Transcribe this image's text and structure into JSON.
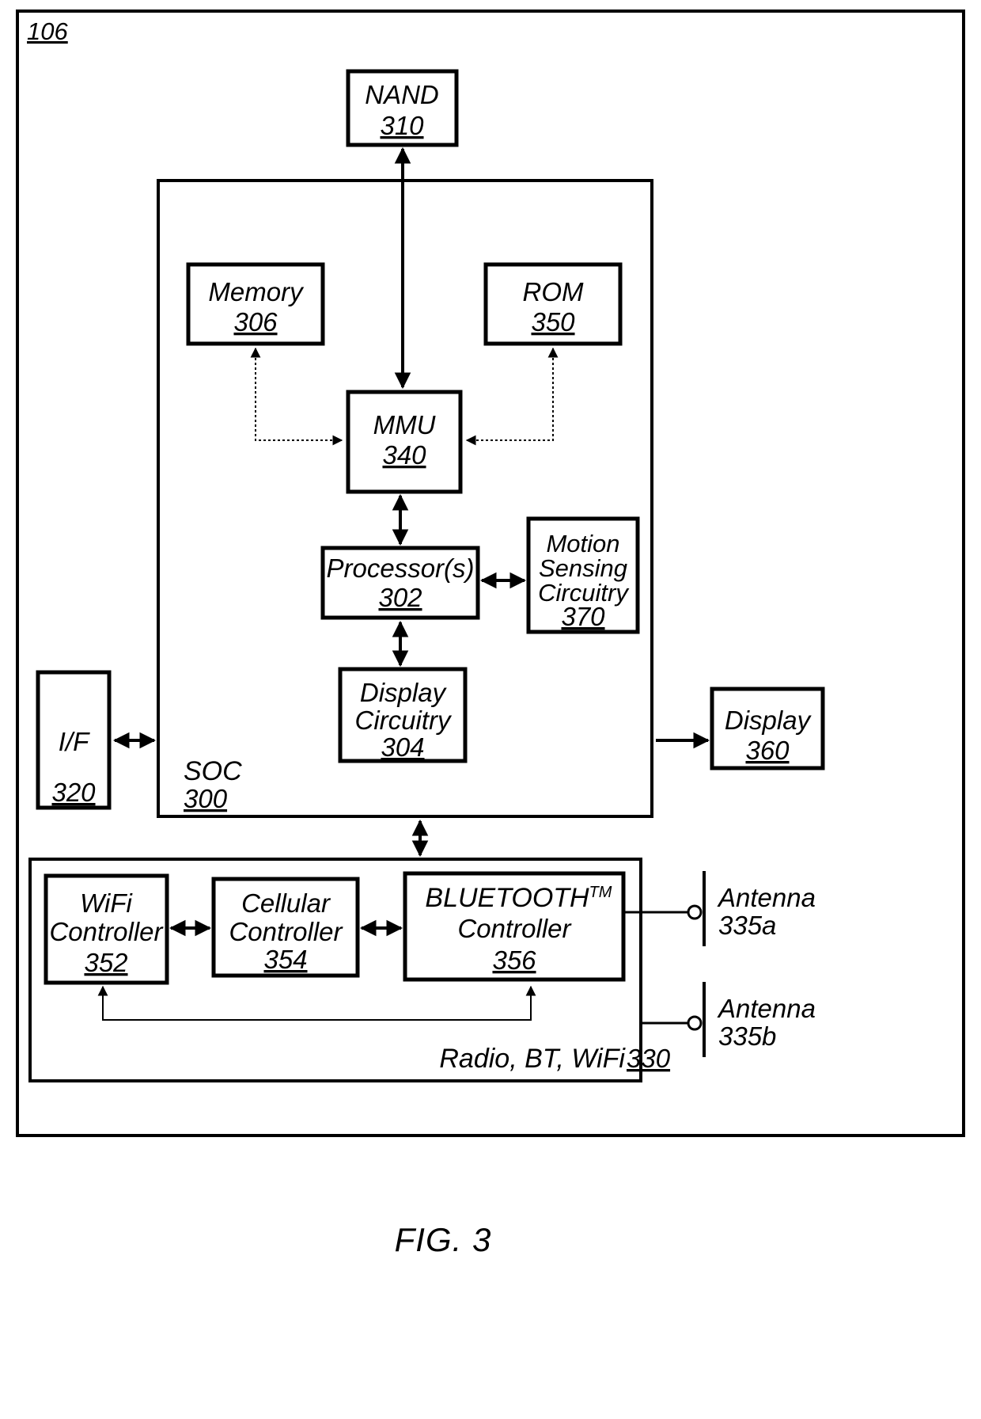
{
  "figure": {
    "caption": "FIG. 3",
    "device_tag": "106"
  },
  "blocks": {
    "nand": {
      "label": "NAND",
      "num": "310"
    },
    "memory": {
      "label": "Memory",
      "num": "306"
    },
    "rom": {
      "label": "ROM",
      "num": "350"
    },
    "mmu": {
      "label": "MMU",
      "num": "340"
    },
    "processor": {
      "label": "Processor(s)",
      "num": "302"
    },
    "motion": {
      "line1": "Motion",
      "line2": "Sensing",
      "line3": "Circuitry",
      "num": "370"
    },
    "display_circuitry": {
      "line1": "Display",
      "line2": "Circuitry",
      "num": "304"
    },
    "interface": {
      "label": "I/F",
      "num": "320"
    },
    "display": {
      "label": "Display",
      "num": "360"
    },
    "soc": {
      "label": "SOC",
      "num": "300"
    },
    "wifi": {
      "line1": "WiFi",
      "line2": "Controller",
      "num": "352"
    },
    "cellular": {
      "line1": "Cellular",
      "line2": "Controller",
      "num": "354"
    },
    "bluetooth": {
      "line1": "BLUETOOTH",
      "trademark": "TM",
      "line2": "Controller",
      "num": "356"
    },
    "radio": {
      "label": "Radio, BT, WiFi",
      "num": "330"
    },
    "antenna_a": {
      "line1": "Antenna",
      "line2": "335a"
    },
    "antenna_b": {
      "line1": "Antenna",
      "line2": "335b"
    }
  },
  "colors": {
    "ink": "#000000",
    "paper": "#ffffff"
  }
}
